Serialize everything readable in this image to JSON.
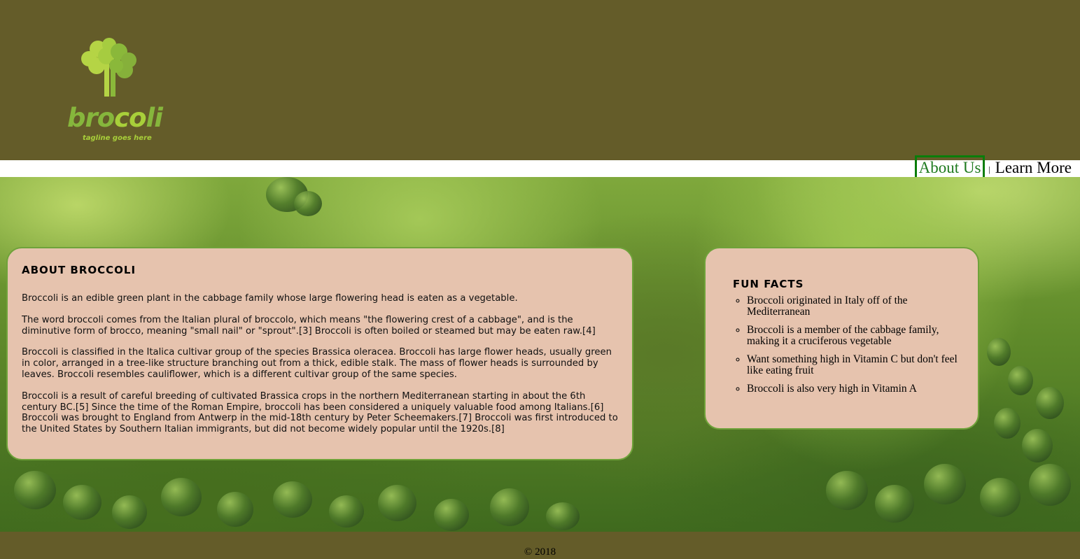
{
  "colors": {
    "header_bg": "#645c29",
    "panel_bg": "#e6c3ae",
    "panel_border": "#6fa23a",
    "active_link": "#1f7a1f"
  },
  "logo": {
    "name_part1": "bro",
    "name_part2": "co",
    "name_part3": "li",
    "tagline": "tagline goes here",
    "icon": "broccoli-tree-icon"
  },
  "nav": {
    "items": [
      {
        "label": "About Us",
        "active": true
      },
      {
        "label": "Learn More",
        "active": false
      }
    ],
    "separator": "|"
  },
  "about": {
    "title": "ABOUT BROCCOLI",
    "paragraphs": [
      "Broccoli is an edible green plant in the cabbage family whose large flowering head is eaten as a vegetable.",
      "The word broccoli comes from the Italian plural of broccolo, which means \"the flowering crest of a cabbage\", and is the diminutive form of brocco, meaning \"small nail\" or \"sprout\".[3] Broccoli is often boiled or steamed but may be eaten raw.[4]",
      "Broccoli is classified in the Italica cultivar group of the species Brassica oleracea. Broccoli has large flower heads, usually green in color, arranged in a tree-like structure branching out from a thick, edible stalk. The mass of flower heads is surrounded by leaves. Broccoli resembles cauliflower, which is a different cultivar group of the same species.",
      "Broccoli is a result of careful breeding of cultivated Brassica crops in the northern Mediterranean starting in about the 6th century BC.[5] Since the time of the Roman Empire, broccoli has been considered a uniquely valuable food among Italians.[6] Broccoli was brought to England from Antwerp in the mid-18th century by Peter Scheemakers.[7] Broccoli was first introduced to the United States by Southern Italian immigrants, but did not become widely popular until the 1920s.[8]"
    ]
  },
  "fun_facts": {
    "title": "FUN FACTS",
    "items": [
      "Broccoli originated in Italy off of the Mediterranean",
      "Broccoli is a member of the cabbage family, making it a cruciferous vegetable",
      "Want something high in Vitamin C but don't feel like eating fruit",
      "Broccoli is also very high in Vitamin A"
    ]
  },
  "footer": {
    "copyright": "© 2018"
  }
}
